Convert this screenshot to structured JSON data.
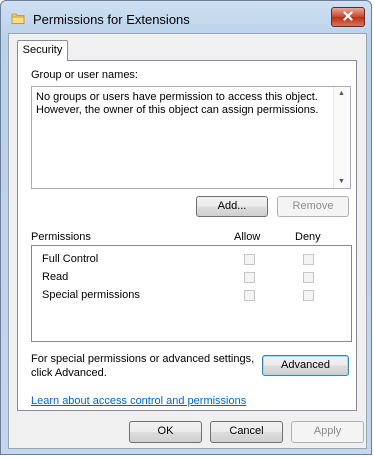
{
  "window": {
    "title": "Permissions for Extensions",
    "icon": "folder-icon"
  },
  "tabs": [
    {
      "label": "Security",
      "selected": true
    }
  ],
  "group_section": {
    "label": "Group or user names:",
    "message": "No groups or users have permission to access this object. However, the owner of this object can assign permissions."
  },
  "buttons": {
    "add": "Add...",
    "remove": "Remove",
    "advanced": "Advanced",
    "ok": "OK",
    "cancel": "Cancel",
    "apply": "Apply"
  },
  "permissions": {
    "header": "Permissions",
    "allow_label": "Allow",
    "deny_label": "Deny",
    "rows": [
      {
        "name": "Full Control",
        "allow": false,
        "deny": false
      },
      {
        "name": "Read",
        "allow": false,
        "deny": false
      },
      {
        "name": "Special permissions",
        "allow": false,
        "deny": false
      }
    ]
  },
  "advanced_note": {
    "line1": "For special permissions or advanced settings,",
    "line2": "click Advanced."
  },
  "help_link": "Learn about access control and permissions"
}
